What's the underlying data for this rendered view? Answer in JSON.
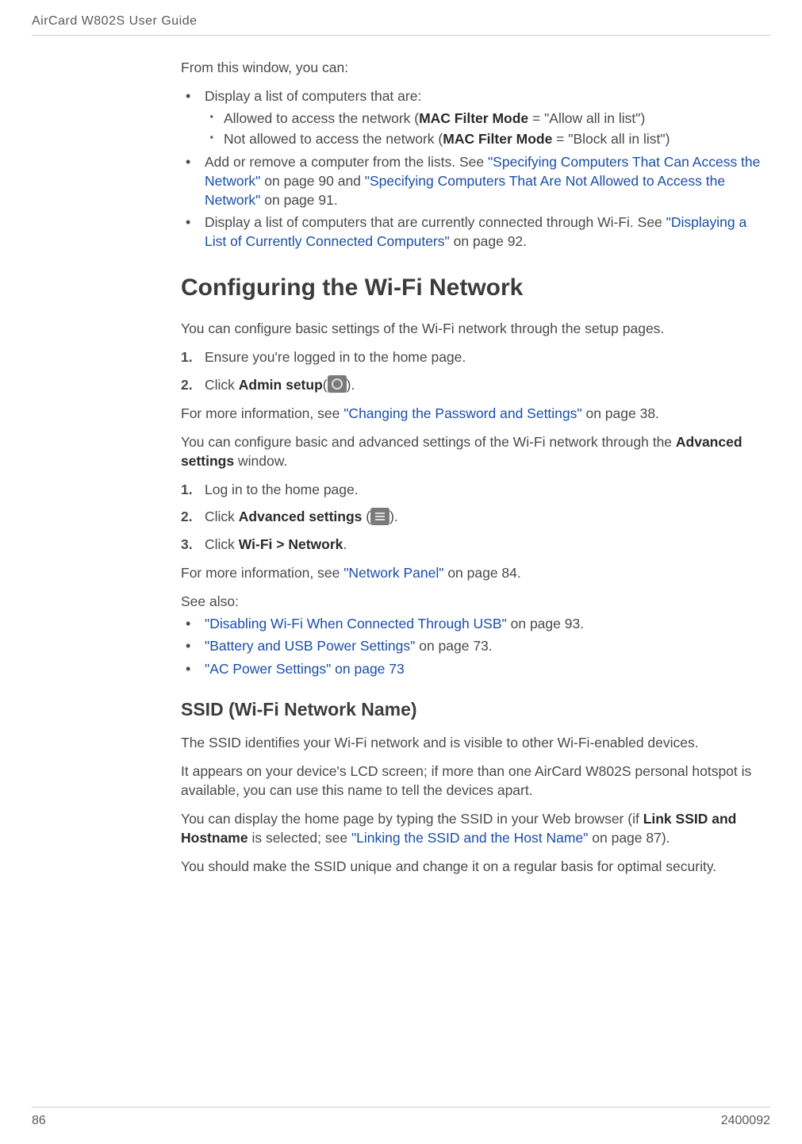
{
  "header": {
    "title": "AirCard W802S User Guide"
  },
  "intro": {
    "lead": "From this window, you can:",
    "b1": "Display a list of computers that are:",
    "b1s1a": "Allowed to access the network (",
    "b1s1b": "MAC Filter Mode",
    "b1s1c": " = \"Allow all in list\")",
    "b1s2a": "Not allowed to access the network (",
    "b1s2b": "MAC Filter Mode",
    "b1s2c": " = \"Block all in list\")",
    "b2a": "Add or remove a computer from the lists. See ",
    "b2link1": "\"Specifying Computers That Can Access the Network\"",
    "b2b": " on page 90 and ",
    "b2link2": "\"Specifying Computers That Are Not Allowed to Access the Network\"",
    "b2c": " on page 91.",
    "b3a": "Display a list of computers that are currently connected through Wi-Fi. See ",
    "b3link": "\"Displaying a List of Currently Connected Computers\"",
    "b3b": " on page 92."
  },
  "config": {
    "heading": "Configuring the Wi-Fi Network",
    "p1": "You can configure basic settings of the Wi-Fi network through the setup pages.",
    "s1_1": "Ensure you're logged in to the home page.",
    "s1_2a": "Click ",
    "s1_2b": "Admin setup",
    "s1_2c": "(",
    "s1_2d": ").",
    "p2a": "For more information, see ",
    "p2link": "\"Changing the Password and Settings\"",
    "p2b": " on page 38.",
    "p3a": "You can configure basic and advanced settings of the Wi-Fi network through the ",
    "p3b": "Advanced settings",
    "p3c": " window.",
    "s2_1": "Log in to the home page.",
    "s2_2a": "Click ",
    "s2_2b": "Advanced settings",
    "s2_2c": " (",
    "s2_2d": ").",
    "s2_3a": "Click ",
    "s2_3b": "Wi-Fi > Network",
    "s2_3c": ".",
    "p4a": "For more information, see ",
    "p4link": "\"Network Panel\"",
    "p4b": " on page 84.",
    "seealso": "See also:",
    "sa1link": "\"Disabling Wi-Fi When Connected Through USB\"",
    "sa1b": " on page 93.",
    "sa2link": "\"Battery and USB Power Settings\"",
    "sa2b": " on page 73.",
    "sa3link": "\"AC Power Settings\" on page 73"
  },
  "ssid": {
    "heading": "SSID (Wi-Fi Network Name)",
    "p1": "The SSID identifies your Wi-Fi network and is visible to other Wi-Fi-enabled devices.",
    "p2": " It appears on your device's LCD screen; if more than one AirCard W802S personal hotspot is available, you can use this name to tell the devices apart.",
    "p3a": "You can display the home page by typing the SSID in your Web browser (if ",
    "p3b": "Link SSID and Hostname",
    "p3c": " is selected; see ",
    "p3link": "\"Linking the SSID and the Host Name\"",
    "p3d": " on page 87).",
    "p4": "You should make the SSID unique and change it on a regular basis for optimal security."
  },
  "footer": {
    "pagenum": "86",
    "docnum": "2400092"
  },
  "icons": {
    "admin_setup": "admin-setup-icon",
    "advanced_settings": "advanced-settings-icon"
  }
}
